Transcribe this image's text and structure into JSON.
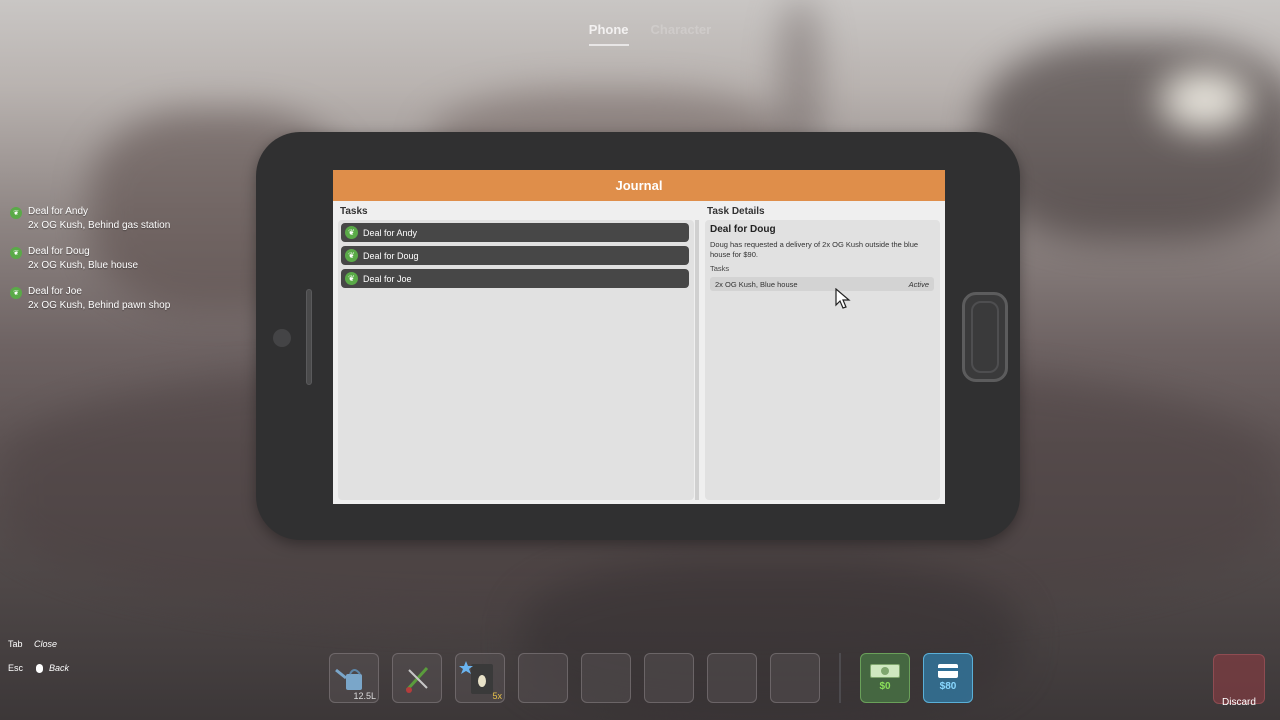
{
  "top_tabs": [
    {
      "label": "Phone",
      "active": true
    },
    {
      "label": "Character",
      "active": false
    }
  ],
  "journal": {
    "title": "Journal",
    "tasks_heading": "Tasks",
    "details_heading": "Task Details",
    "tasks": [
      {
        "label": "Deal for Andy",
        "icon": "weed-leaf-icon"
      },
      {
        "label": "Deal for Doug",
        "icon": "weed-leaf-icon"
      },
      {
        "label": "Deal for Joe",
        "icon": "weed-leaf-icon"
      }
    ],
    "selected": {
      "title": "Deal for Doug",
      "description": "Doug has requested a delivery of 2x OG Kush outside the blue house for $90.",
      "subtasks_label": "Tasks",
      "subtasks": [
        {
          "label": "2x OG Kush, Blue house",
          "status": "Active"
        }
      ]
    }
  },
  "quest_tracker": [
    {
      "title": "Deal for Andy",
      "detail": "2x OG Kush, Behind gas station"
    },
    {
      "title": "Deal for Doug",
      "detail": "2x OG Kush, Blue house"
    },
    {
      "title": "Deal for Joe",
      "detail": "2x OG Kush, Behind pawn shop"
    }
  ],
  "key_hints": [
    {
      "key": "Tab",
      "action": "Close"
    },
    {
      "key": "Esc",
      "action": "Back"
    }
  ],
  "hotbar": {
    "slots": [
      {
        "item": "watering-can-icon",
        "qty": "12.5L"
      },
      {
        "item": "trimmers-icon",
        "qty": ""
      },
      {
        "item": "seed-packet-icon",
        "qty": "5x"
      },
      {
        "item": "",
        "qty": ""
      },
      {
        "item": "",
        "qty": ""
      },
      {
        "item": "",
        "qty": ""
      },
      {
        "item": "",
        "qty": ""
      },
      {
        "item": "",
        "qty": ""
      }
    ],
    "cash": "$0",
    "bank": "$80",
    "discard_label": "Discard"
  },
  "colors": {
    "header_orange": "#df8e4a",
    "leaf_green": "#5aaa48",
    "cash_green": "#8be05a",
    "card_blue": "#8ad8ff"
  }
}
